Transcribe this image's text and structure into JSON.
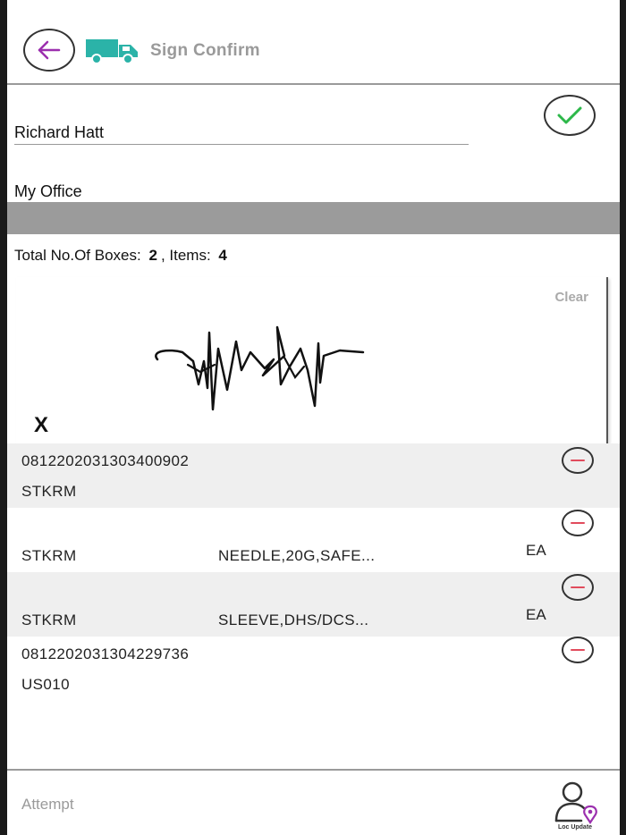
{
  "header": {
    "title": "Sign Confirm",
    "back_icon": "back-arrow-icon",
    "truck_icon": "delivery-truck-icon",
    "colors": {
      "accent": "#9b2fae",
      "truck": "#2bb3a8"
    }
  },
  "form": {
    "recipient_name": "Richard Hatt",
    "location": "My Office",
    "confirm_icon": "check-icon",
    "totals_label": "Total No.Of Boxes:",
    "boxes": "2",
    "items_label": ", Items:",
    "items": "4"
  },
  "signature": {
    "clear_label": "Clear",
    "x_mark": "X"
  },
  "list": [
    {
      "line1": "0812202031303400902",
      "line2": "STKRM",
      "desc": "",
      "uom": ""
    },
    {
      "line1": "",
      "line2": "STKRM",
      "desc": "NEEDLE,20G,SAFE...",
      "uom": "EA"
    },
    {
      "line1": "",
      "line2": "STKRM",
      "desc": "SLEEVE,DHS/DCS...",
      "uom": "EA"
    },
    {
      "line1": "0812202031304229736",
      "line2": "US010",
      "desc": "",
      "uom": ""
    }
  ],
  "footer": {
    "attempt_label": "Attempt",
    "loc_update_label": "Loc Update",
    "loc_icon": "location-user-icon"
  }
}
